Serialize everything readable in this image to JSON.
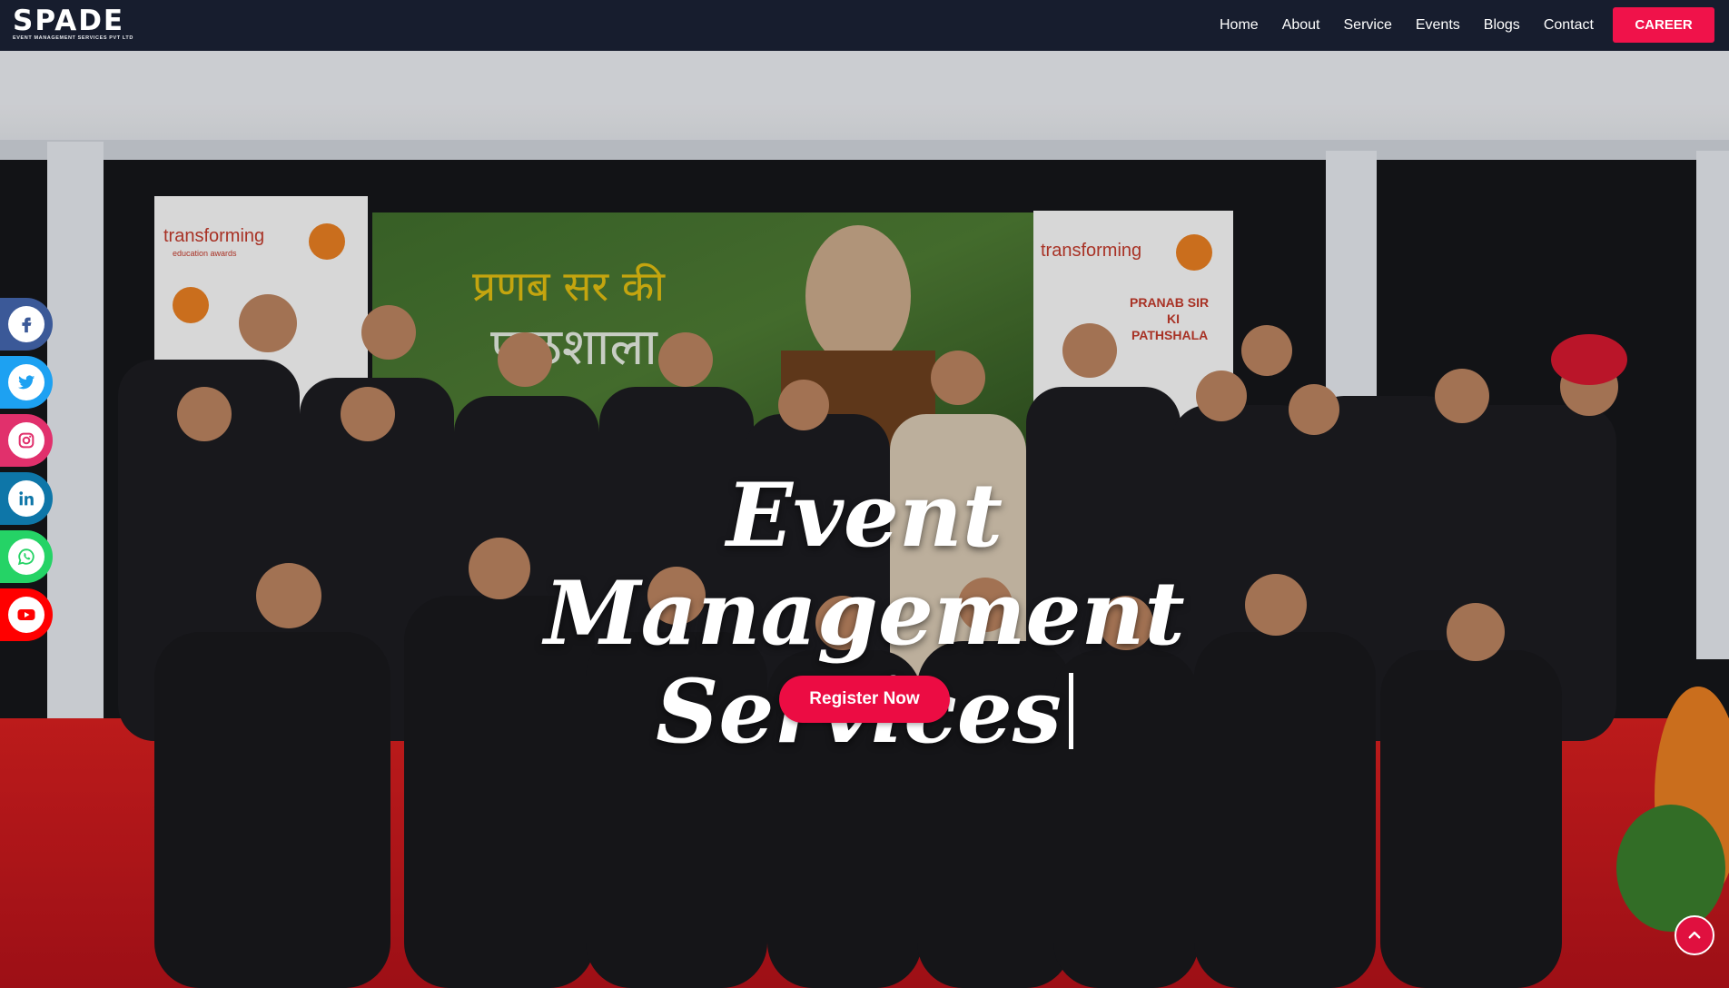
{
  "brand": {
    "name": "SPADE",
    "tagline": "EVENT MANAGEMENT SERVICES PVT LTD"
  },
  "nav": {
    "links": [
      "Home",
      "About",
      "Service",
      "Events",
      "Blogs",
      "Contact"
    ],
    "cta": "CAREER"
  },
  "hero": {
    "title_line1": "Event Management",
    "title_line2": "Services",
    "button": "Register Now",
    "backdrop": {
      "banner_left": "transforming",
      "banner_left_sub": "education awards",
      "banner_right_lines": [
        "PRANAB SIR",
        "KI",
        "PATHSHALA"
      ],
      "screen_text_hindi": "प्रणब सर की पाठशाला"
    }
  },
  "social": [
    {
      "name": "facebook",
      "icon": "facebook-icon",
      "color": "#3b5998"
    },
    {
      "name": "twitter",
      "icon": "twitter-icon",
      "color": "#1da1f2"
    },
    {
      "name": "instagram",
      "icon": "instagram-icon",
      "color": "#e1306c"
    },
    {
      "name": "linkedin",
      "icon": "linkedin-icon",
      "color": "#0e76a8"
    },
    {
      "name": "whatsapp",
      "icon": "whatsapp-icon",
      "color": "#25d366"
    },
    {
      "name": "youtube",
      "icon": "youtube-icon",
      "color": "#ff0000"
    }
  ],
  "colors": {
    "accent": "#f0124a",
    "nav_bg": "#171d2e"
  },
  "back_to_top_icon": "chevron-up-icon"
}
